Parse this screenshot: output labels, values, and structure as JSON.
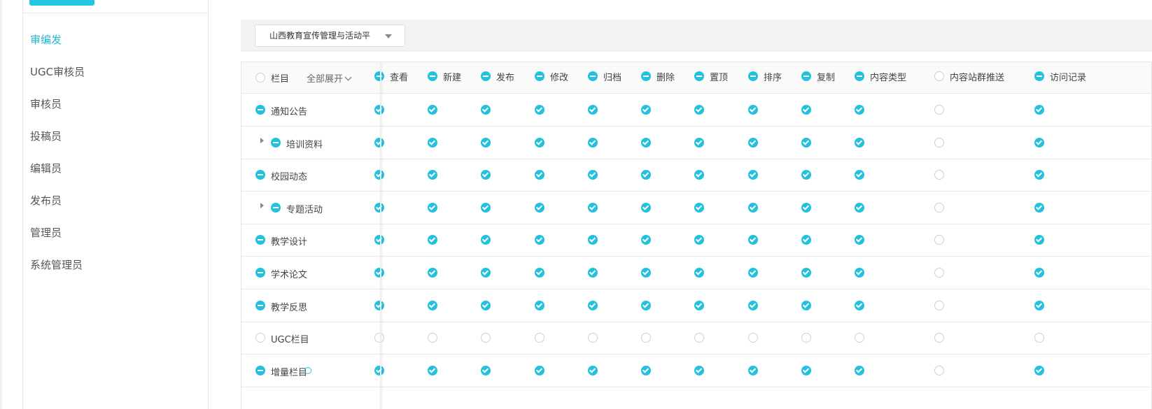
{
  "sidebar": {
    "roles": [
      {
        "label": "审编发",
        "active": true
      },
      {
        "label": "UGC审核员",
        "active": false
      },
      {
        "label": "审核员",
        "active": false
      },
      {
        "label": "投稿员",
        "active": false
      },
      {
        "label": "编辑员",
        "active": false
      },
      {
        "label": "发布员",
        "active": false
      },
      {
        "label": "管理员",
        "active": false
      },
      {
        "label": "系统管理员",
        "active": false
      }
    ]
  },
  "site_select": {
    "value": "山西教育宣传管理与活动平"
  },
  "grid": {
    "header": {
      "column_label": "栏目",
      "expand_all_label": "全部展开",
      "select_all_state": "unchecked",
      "permissions": [
        {
          "label": "查看",
          "state": "partial"
        },
        {
          "label": "新建",
          "state": "partial"
        },
        {
          "label": "发布",
          "state": "partial"
        },
        {
          "label": "修改",
          "state": "partial"
        },
        {
          "label": "归档",
          "state": "partial"
        },
        {
          "label": "删除",
          "state": "partial"
        },
        {
          "label": "置顶",
          "state": "partial"
        },
        {
          "label": "排序",
          "state": "partial"
        },
        {
          "label": "复制",
          "state": "partial"
        },
        {
          "label": "内容类型",
          "state": "partial"
        },
        {
          "label": "内容站群推送",
          "state": "unchecked"
        },
        {
          "label": "访问记录",
          "state": "partial"
        }
      ]
    },
    "rows": [
      {
        "name": "通知公告",
        "expandable": false,
        "state": "partial",
        "perms": [
          "checked",
          "checked",
          "checked",
          "checked",
          "checked",
          "checked",
          "checked",
          "checked",
          "checked",
          "checked",
          "unchecked",
          "checked"
        ]
      },
      {
        "name": "培训资料",
        "expandable": true,
        "state": "partial",
        "perms": [
          "checked",
          "checked",
          "checked",
          "checked",
          "checked",
          "checked",
          "checked",
          "checked",
          "checked",
          "checked",
          "unchecked",
          "checked"
        ]
      },
      {
        "name": "校园动态",
        "expandable": false,
        "state": "partial",
        "perms": [
          "checked",
          "checked",
          "checked",
          "checked",
          "checked",
          "checked",
          "checked",
          "checked",
          "checked",
          "checked",
          "unchecked",
          "checked"
        ]
      },
      {
        "name": "专题活动",
        "expandable": true,
        "state": "partial",
        "perms": [
          "checked",
          "checked",
          "checked",
          "checked",
          "checked",
          "checked",
          "checked",
          "checked",
          "checked",
          "checked",
          "unchecked",
          "checked"
        ]
      },
      {
        "name": "教学设计",
        "expandable": false,
        "state": "partial",
        "perms": [
          "checked",
          "checked",
          "checked",
          "checked",
          "checked",
          "checked",
          "checked",
          "checked",
          "checked",
          "checked",
          "unchecked",
          "checked"
        ]
      },
      {
        "name": "学术论文",
        "expandable": false,
        "state": "partial",
        "perms": [
          "checked",
          "checked",
          "checked",
          "checked",
          "checked",
          "checked",
          "checked",
          "checked",
          "checked",
          "checked",
          "unchecked",
          "checked"
        ]
      },
      {
        "name": "教学反思",
        "expandable": false,
        "state": "partial",
        "perms": [
          "checked",
          "checked",
          "checked",
          "checked",
          "checked",
          "checked",
          "checked",
          "checked",
          "checked",
          "checked",
          "unchecked",
          "checked"
        ]
      },
      {
        "name": "UGC栏目",
        "expandable": false,
        "state": "unchecked",
        "perms": [
          "unchecked",
          "unchecked",
          "unchecked",
          "unchecked",
          "unchecked",
          "unchecked",
          "unchecked",
          "unchecked",
          "unchecked",
          "unchecked",
          "unchecked",
          "unchecked"
        ]
      },
      {
        "name": "增量栏目",
        "expandable": false,
        "state": "partial",
        "perms": [
          "checked",
          "checked",
          "checked",
          "checked",
          "checked",
          "checked",
          "checked",
          "checked",
          "checked",
          "checked",
          "unchecked",
          "checked"
        ]
      }
    ]
  },
  "colors": {
    "accent": "#23c1dd",
    "active_text": "#23b7d6"
  }
}
